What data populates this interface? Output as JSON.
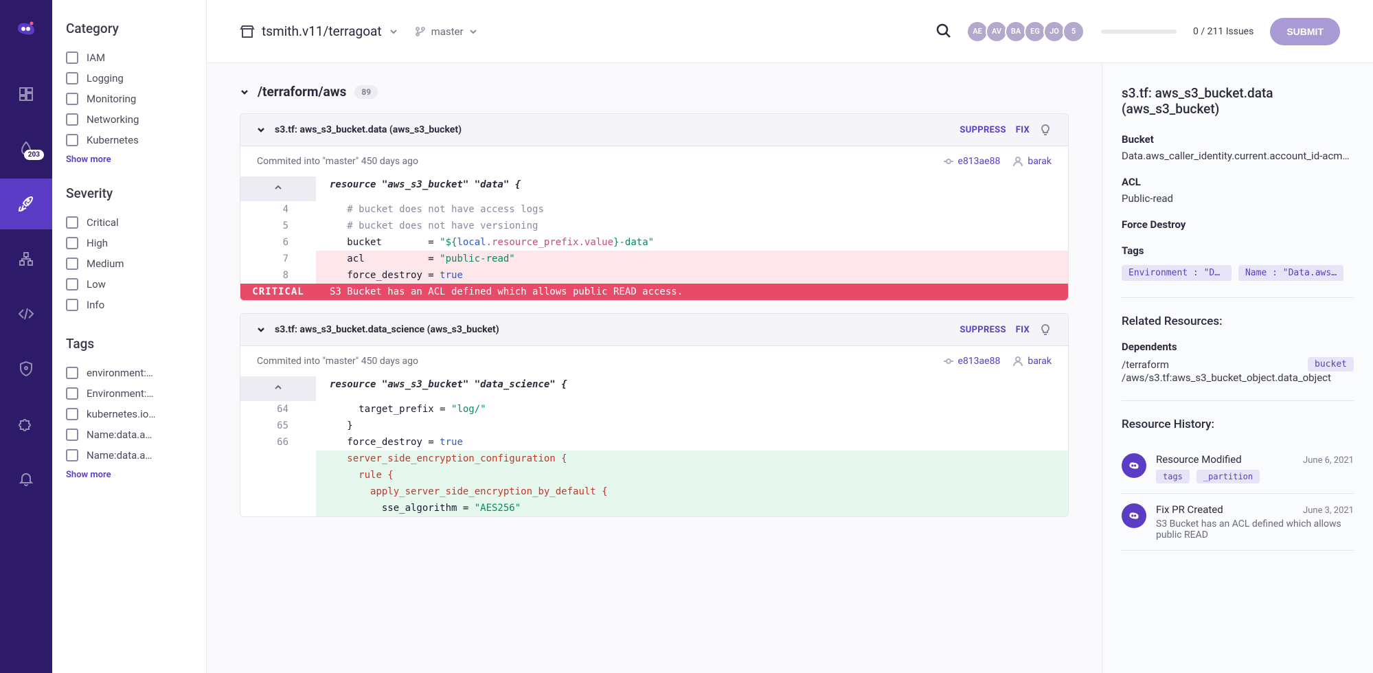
{
  "nav": {
    "badge": "203"
  },
  "topbar": {
    "repo": "tsmith.v11/terragoat",
    "branch": "master",
    "avatars": [
      "AE",
      "AV",
      "BA",
      "EG",
      "JO",
      "5"
    ],
    "issue_count": "0 / 211 Issues",
    "submit": "SUBMIT"
  },
  "filters": {
    "category": {
      "title": "Category",
      "items": [
        "IAM",
        "Logging",
        "Monitoring",
        "Networking",
        "Kubernetes"
      ],
      "show_more": "Show more"
    },
    "severity": {
      "title": "Severity",
      "items": [
        "Critical",
        "High",
        "Medium",
        "Low",
        "Info"
      ]
    },
    "tags": {
      "title": "Tags",
      "items": [
        "environment:…",
        "Environment:…",
        "kubernetes.io…",
        "Name:data.a…",
        "Name:data.a…"
      ],
      "show_more": "Show more"
    }
  },
  "path": {
    "text": "/terraform/aws",
    "count": "89"
  },
  "actions": {
    "suppress": "SUPPRESS",
    "fix": "FIX"
  },
  "issues": [
    {
      "title": "s3.tf: aws_s3_bucket.data (aws_s3_bucket)",
      "commit_text": "Commited into \"master\" 450 days ago",
      "hash": "e813ae88",
      "author": "barak",
      "critical_label": "CRITICAL",
      "critical_msg": "S3 Bucket has an ACL defined which allows public READ access.",
      "lines": {
        "l0": "resource \"aws_s3_bucket\" \"data\" {",
        "l4": "# bucket does not have access logs",
        "l5": "# bucket does not have versioning",
        "l6a": "bucket        = ",
        "l6b": "\"${",
        "l6c": "local",
        "l6d": ".resource_prefix.value",
        "l6e": "}-data\"",
        "l7a": "acl           = ",
        "l7b": "\"public-read\"",
        "l8a": "force_destroy = ",
        "l8b": "true"
      },
      "nums": {
        "n4": "4",
        "n5": "5",
        "n6": "6",
        "n7": "7",
        "n8": "8"
      }
    },
    {
      "title": "s3.tf: aws_s3_bucket.data_science (aws_s3_bucket)",
      "commit_text": "Commited into \"master\" 450 days ago",
      "hash": "e813ae88",
      "author": "barak",
      "lines": {
        "l0": "resource \"aws_s3_bucket\" \"data_science\" {",
        "l64a": "target_prefix = ",
        "l64b": "\"log/\"",
        "l65": "}",
        "l66a": "force_destroy = ",
        "l66b": "true",
        "g1": "server_side_encryption_configuration {",
        "g2": "rule {",
        "g3": "apply_server_side_encryption_by_default {",
        "g4a": "sse_algorithm = ",
        "g4b": "\"AES256\""
      },
      "nums": {
        "n64": "64",
        "n65": "65",
        "n66": "66"
      }
    }
  ],
  "detail": {
    "title": "s3.tf: aws_s3_bucket.data (aws_s3_bucket)",
    "bucket_label": "Bucket",
    "bucket_value": "Data.aws_caller_identity.current.account_id-acme-dev-…",
    "acl_label": "ACL",
    "acl_value": "Public-read",
    "force_label": "Force Destroy",
    "tags_label": "Tags",
    "tag1": "Environment : \"Da…",
    "tag2": "Name : \"Data.aws…",
    "related_title": "Related Resources:",
    "dependents_label": "Dependents",
    "dep_paths": [
      "/terraform",
      "/aws/s3.tf:aws_s3_bucket_object.data_object"
    ],
    "dep_chip": "bucket",
    "history_title": "Resource History:",
    "history": [
      {
        "title": "Resource Modified",
        "date": "June 6, 2021",
        "chips": [
          "tags",
          "_partition"
        ]
      },
      {
        "title": "Fix PR Created",
        "date": "June 3, 2021",
        "desc": "S3 Bucket has an ACL defined which allows public READ"
      }
    ]
  }
}
